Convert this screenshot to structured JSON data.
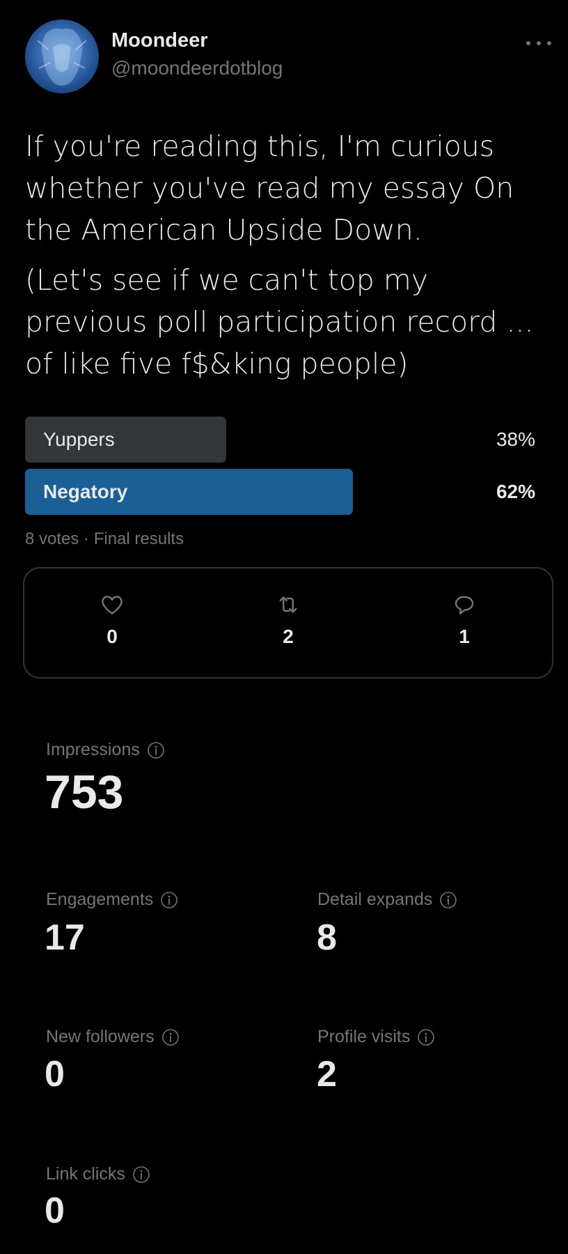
{
  "user": {
    "display_name": "Moondeer",
    "handle": "@moondeerdotblog"
  },
  "tweet": {
    "paragraph1": "If you're reading this, I'm curious whether you've read my essay On the American Upside Down.",
    "paragraph2": "(Let's see if we can't top my previous poll participation record ... of like five f$&king people)"
  },
  "poll": {
    "options": [
      {
        "label": "Yuppers",
        "percent": "38%",
        "fraction": 0.38
      },
      {
        "label": "Negatory",
        "percent": "62%",
        "fraction": 0.62
      }
    ],
    "meta": "8 votes · Final results"
  },
  "actions": {
    "likes": "0",
    "retweets": "2",
    "replies": "1"
  },
  "metrics": {
    "impressions": {
      "label": "Impressions",
      "value": "753"
    },
    "engagements": {
      "label": "Engagements",
      "value": "17"
    },
    "detail_expands": {
      "label": "Detail expands",
      "value": "8"
    },
    "new_followers": {
      "label": "New followers",
      "value": "0"
    },
    "profile_visits": {
      "label": "Profile visits",
      "value": "2"
    },
    "link_clicks": {
      "label": "Link clicks",
      "value": "0"
    }
  },
  "colors": {
    "background": "#000000",
    "text": "#e7e9ea",
    "secondary_text": "#71767b",
    "poll_loser_bar": "#333639",
    "poll_winner_bar": "#1a5f96",
    "border": "#2f3336"
  },
  "icons": [
    "more-icon",
    "heart-icon",
    "retweet-icon",
    "reply-icon",
    "info-icon"
  ]
}
